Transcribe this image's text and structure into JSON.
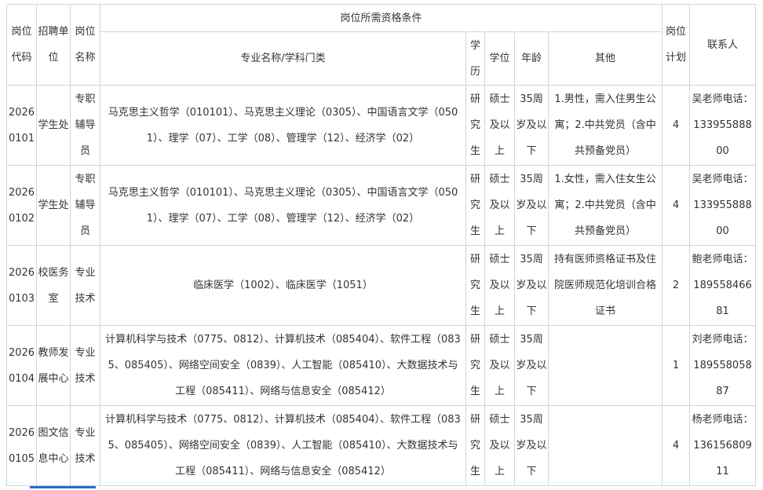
{
  "headers": {
    "code": "岗位代码",
    "unit": "招聘单位",
    "position": "岗位名称",
    "requirements": "岗位所需资格条件",
    "major": "专业名称/学科门类",
    "education": "学历",
    "degree": "学位",
    "age": "年龄",
    "other": "其他",
    "plan": "岗位计划",
    "contact": "联系人"
  },
  "rows": [
    {
      "code": "20260101",
      "unit": "学生处",
      "position": "专职辅导员",
      "major": "马克思主义哲学（010101）、马克思主义理论（0305）、中国语言文学（0501）、理学（07）、工学（08）、管理学（12）、经济学（02）",
      "education": "研究生",
      "degree": "硕士及以上",
      "age": "35周岁及以下",
      "other": "1.男性，需入住男生公寓；2.中共党员（含中共预备党员）",
      "plan": "4",
      "contact": "吴老师电话：13395588800"
    },
    {
      "code": "20260102",
      "unit": "学生处",
      "position": "专职辅导员",
      "major": "马克思主义哲学（010101）、马克思主义理论（0305）、中国语言文学（0501）、理学（07）、工学（08）、管理学（12）、经济学（02）",
      "education": "研究生",
      "degree": "硕士及以上",
      "age": "35周岁及以下",
      "other": "1.女性，需入住女生公寓；2.中共党员（含中共预备党员）",
      "plan": "4",
      "contact": "吴老师电话：13395588800"
    },
    {
      "code": "20260103",
      "unit": "校医务室",
      "position": "专业技术",
      "major": "临床医学（1002）、临床医学（1051）",
      "education": "研究生",
      "degree": "硕士及以上",
      "age": "35周岁及以下",
      "other": "持有医师资格证书及住院医师规范化培训合格证书",
      "plan": "2",
      "contact": "鲍老师电话：18955846681"
    },
    {
      "code": "20260104",
      "unit": "教师发展中心",
      "position": "专业技术",
      "major": "计算机科学与技术（0775、0812）、计算机技术（085404）、软件工程（0835、085405）、网络空间安全（0839）、人工智能（085410）、大数据技术与工程（085411）、网络与信息安全（085412）",
      "education": "研究生",
      "degree": "硕士及以上",
      "age": "35周岁及以下",
      "other": "",
      "plan": "1",
      "contact": "刘老师电话：18955805887"
    },
    {
      "code": "20260105",
      "unit": "图文信息中心",
      "position": "专业技术",
      "major": "计算机科学与技术（0775、0812）、计算机技术（085404）、软件工程（0835、085405）、网络空间安全（0839）、人工智能（085410）、大数据技术与工程（085411）、网络与信息安全（085412）",
      "education": "研究生",
      "degree": "硕士及以上",
      "age": "35周岁及以下",
      "other": "",
      "plan": "4",
      "contact": "杨老师电话：13615680911"
    }
  ]
}
